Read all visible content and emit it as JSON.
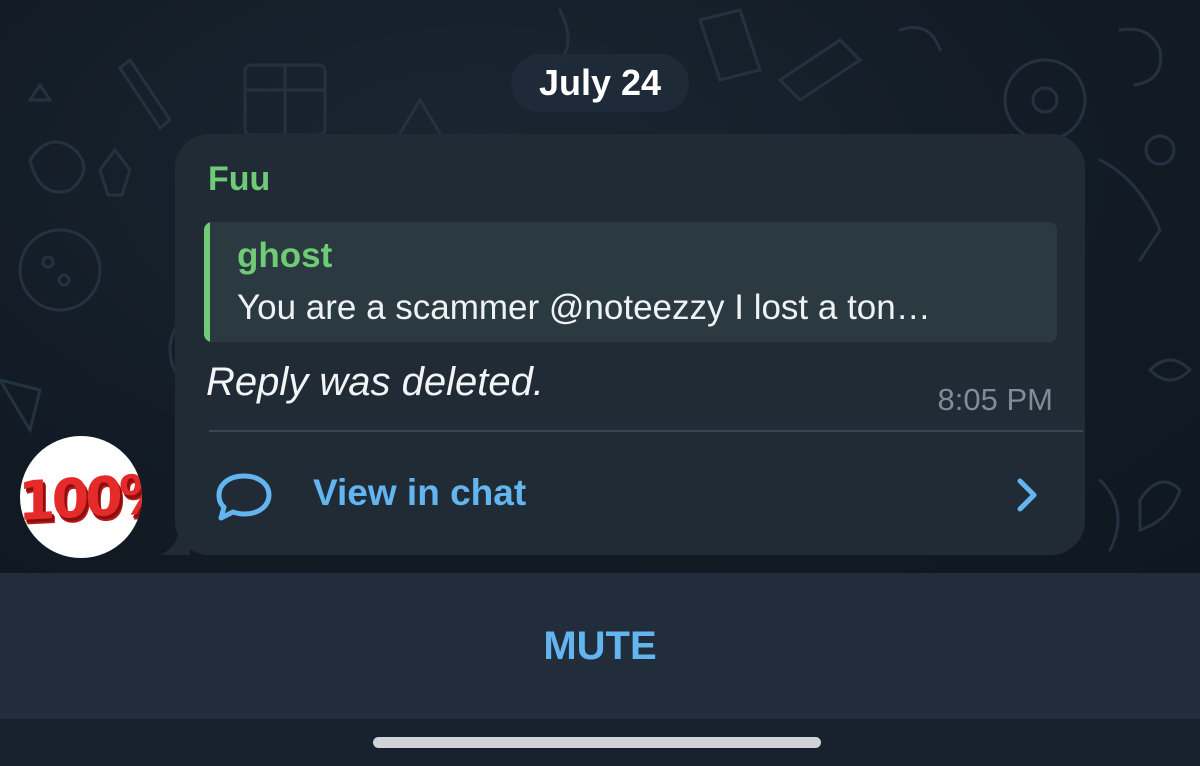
{
  "chat": {
    "date_separator": "July 24",
    "message": {
      "sender": "Fuu",
      "reply_quote": {
        "author": "ghost",
        "text": "You are a scammer @noteezzy I lost a ton…"
      },
      "text": "Reply was deleted.",
      "time": "8:05 PM",
      "action": {
        "label": "View in chat",
        "icon": "chat-bubble-icon",
        "chevron": "chevron-right-icon"
      }
    },
    "avatar": {
      "text": "100%"
    }
  },
  "bottom_bar": {
    "mute_label": "MUTE"
  },
  "colors": {
    "accent": "#63b5ef",
    "sender_green": "#6fcb76",
    "bubble": "#202b36",
    "background": "#131c26",
    "bar": "#212d3b"
  }
}
